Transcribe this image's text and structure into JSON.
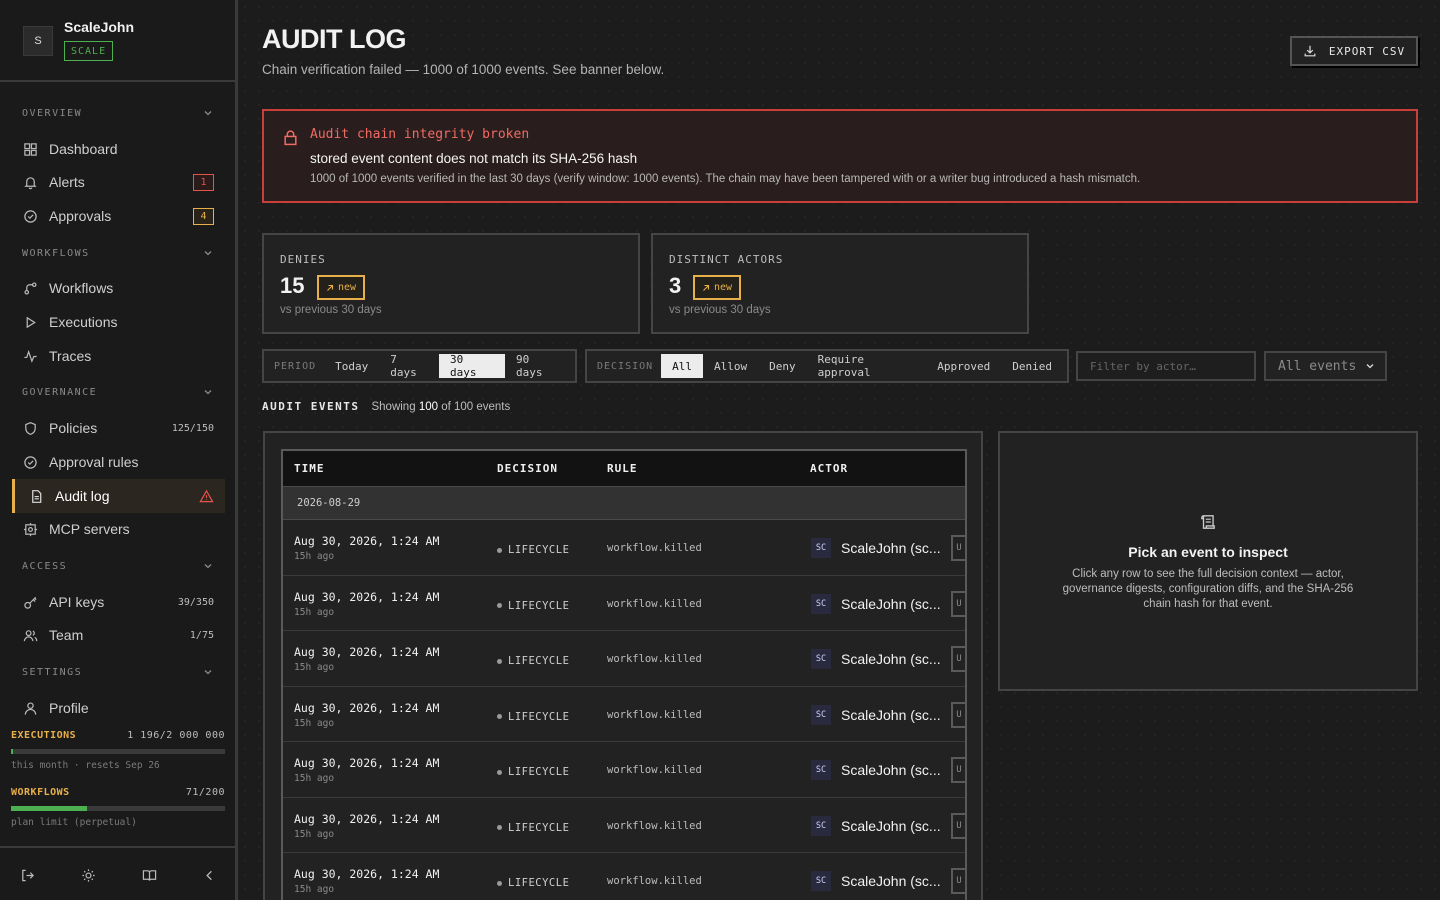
{
  "brand": {
    "initial": "S",
    "name": "ScaleJohn",
    "plan": "SCALE"
  },
  "sidebar": {
    "sections": [
      {
        "title": "OVERVIEW"
      },
      {
        "title": "WORKFLOWS"
      },
      {
        "title": "GOVERNANCE"
      },
      {
        "title": "ACCESS"
      },
      {
        "title": "SETTINGS"
      }
    ],
    "items": {
      "dashboard": {
        "label": "Dashboard"
      },
      "alerts": {
        "label": "Alerts",
        "badge": "1"
      },
      "approvals": {
        "label": "Approvals",
        "badge": "4"
      },
      "workflows": {
        "label": "Workflows"
      },
      "executions": {
        "label": "Executions"
      },
      "traces": {
        "label": "Traces"
      },
      "policies": {
        "label": "Policies",
        "count": "125/150"
      },
      "approval_rules": {
        "label": "Approval rules"
      },
      "audit_log": {
        "label": "Audit log"
      },
      "mcp_servers": {
        "label": "MCP servers"
      },
      "api_keys": {
        "label": "API keys",
        "count": "39/350"
      },
      "team": {
        "label": "Team",
        "count": "1/75"
      },
      "profile": {
        "label": "Profile"
      }
    },
    "usage": {
      "executions": {
        "label": "EXECUTIONS",
        "value": "1 196/2 000 000",
        "fraction": 0.0006,
        "note": "this month · resets Sep 26"
      },
      "workflows": {
        "label": "WORKFLOWS",
        "value": "71/200",
        "fraction": 0.355,
        "note": "plan limit (perpetual)"
      }
    }
  },
  "header": {
    "title": "AUDIT LOG",
    "subtitle": "Chain verification failed — 1000 of 1000 events. See banner below.",
    "export_label": "EXPORT CSV"
  },
  "banner": {
    "title": "Audit chain integrity broken",
    "message": "stored event content does not match its SHA-256 hash",
    "detail": "1000 of 1000 events verified in the last 30 days (verify window: 1000 events). The chain may have been tampered with or a writer bug introduced a hash mismatch.",
    "color": "#c9403a"
  },
  "stats": [
    {
      "label": "DENIES",
      "value": "15",
      "tag": "new",
      "note": "vs previous 30 days"
    },
    {
      "label": "DISTINCT ACTORS",
      "value": "3",
      "tag": "new",
      "note": "vs previous 30 days"
    }
  ],
  "filters": {
    "period_label": "PERIOD",
    "period_options": [
      "Today",
      "7 days",
      "30 days",
      "90 days"
    ],
    "period_selected": "30 days",
    "decision_label": "DECISION",
    "decision_options": [
      "All",
      "Allow",
      "Deny",
      "Require approval",
      "Approved",
      "Denied"
    ],
    "decision_selected": "All",
    "actor_placeholder": "Filter by actor…",
    "events_select": "All events"
  },
  "events": {
    "title": "AUDIT EVENTS",
    "showing_prefix": "Showing",
    "showing_count": "100",
    "showing_suffix": "of 100 events",
    "columns": [
      "TIME",
      "DECISION",
      "RULE",
      "ACTOR"
    ],
    "date_group": "2026-08-29",
    "rows": [
      {
        "time": "Aug 30, 2026, 1:24 AM",
        "ago": "15h ago",
        "decision": "LIFECYCLE",
        "rule": "workflow.killed",
        "avatar": "SC",
        "actor": "ScaleJohn (sc...",
        "trail": "U"
      },
      {
        "time": "Aug 30, 2026, 1:24 AM",
        "ago": "15h ago",
        "decision": "LIFECYCLE",
        "rule": "workflow.killed",
        "avatar": "SC",
        "actor": "ScaleJohn (sc...",
        "trail": "U"
      },
      {
        "time": "Aug 30, 2026, 1:24 AM",
        "ago": "15h ago",
        "decision": "LIFECYCLE",
        "rule": "workflow.killed",
        "avatar": "SC",
        "actor": "ScaleJohn (sc...",
        "trail": "U"
      },
      {
        "time": "Aug 30, 2026, 1:24 AM",
        "ago": "15h ago",
        "decision": "LIFECYCLE",
        "rule": "workflow.killed",
        "avatar": "SC",
        "actor": "ScaleJohn (sc...",
        "trail": "U"
      },
      {
        "time": "Aug 30, 2026, 1:24 AM",
        "ago": "15h ago",
        "decision": "LIFECYCLE",
        "rule": "workflow.killed",
        "avatar": "SC",
        "actor": "ScaleJohn (sc...",
        "trail": "U"
      },
      {
        "time": "Aug 30, 2026, 1:24 AM",
        "ago": "15h ago",
        "decision": "LIFECYCLE",
        "rule": "workflow.killed",
        "avatar": "SC",
        "actor": "ScaleJohn (sc...",
        "trail": "U"
      },
      {
        "time": "Aug 30, 2026, 1:24 AM",
        "ago": "15h ago",
        "decision": "LIFECYCLE",
        "rule": "workflow.killed",
        "avatar": "SC",
        "actor": "ScaleJohn (sc...",
        "trail": "U"
      }
    ]
  },
  "inspector": {
    "title": "Pick an event to inspect",
    "description": "Click any row to see the full decision context — actor, governance digests, configuration diffs, and the SHA-256 chain hash for that event."
  },
  "colors": {
    "accent": "#e8b04a",
    "danger": "#c9403a",
    "success": "#4caf50"
  }
}
